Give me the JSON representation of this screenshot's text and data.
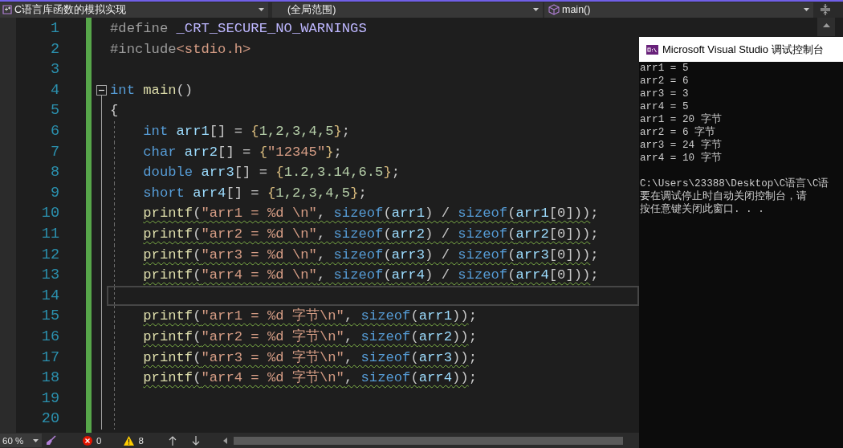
{
  "navigation_bar": {
    "project": "C语言库函数的模拟实现",
    "scope": "(全局范围)",
    "member": "main()"
  },
  "editor": {
    "change_bar": {
      "saved": true
    },
    "lines": [
      {
        "number": "1",
        "current": false,
        "tokens": [
          {
            "kind": "preprocessor",
            "text": "#define "
          },
          {
            "kind": "macro",
            "text": "_CRT_SECURE_NO_WARNINGS"
          }
        ]
      },
      {
        "number": "2",
        "current": false,
        "tokens": [
          {
            "kind": "preprocessor",
            "text": "#include"
          },
          {
            "kind": "header",
            "text": "<stdio.h>"
          }
        ]
      },
      {
        "number": "3",
        "current": false
      },
      {
        "number": "4",
        "current": false,
        "fold": {
          "expanded": true
        },
        "tokens": [
          {
            "kind": "keyword",
            "text": "int "
          },
          {
            "kind": "function",
            "text": "main"
          },
          {
            "kind": "punct",
            "text": "()"
          }
        ]
      },
      {
        "number": "5",
        "current": false,
        "tokens": [
          {
            "kind": "punct",
            "text": "{"
          }
        ]
      },
      {
        "number": "6",
        "current": false,
        "tokens": [
          {
            "kind": "indent"
          },
          {
            "kind": "keyword",
            "text": "int "
          },
          {
            "kind": "variable",
            "text": "arr1"
          },
          {
            "kind": "punct",
            "text": "[] = "
          },
          {
            "kind": "bracket",
            "text": "{"
          },
          {
            "kind": "number",
            "text": "1,2,3,4,5"
          },
          {
            "kind": "bracket",
            "text": "}"
          },
          {
            "kind": "punct",
            "text": ";"
          }
        ]
      },
      {
        "number": "7",
        "current": false,
        "tokens": [
          {
            "kind": "indent"
          },
          {
            "kind": "keyword",
            "text": "char "
          },
          {
            "kind": "variable",
            "text": "arr2"
          },
          {
            "kind": "punct",
            "text": "[] = "
          },
          {
            "kind": "bracket",
            "text": "{"
          },
          {
            "kind": "string",
            "text": "\"12345\""
          },
          {
            "kind": "bracket",
            "text": "}"
          },
          {
            "kind": "punct",
            "text": ";"
          }
        ]
      },
      {
        "number": "8",
        "current": false,
        "tokens": [
          {
            "kind": "indent"
          },
          {
            "kind": "keyword",
            "text": "double "
          },
          {
            "kind": "variable",
            "text": "arr3"
          },
          {
            "kind": "punct",
            "text": "[] = "
          },
          {
            "kind": "bracket",
            "text": "{"
          },
          {
            "kind": "number",
            "text": "1.2,3.14,6.5"
          },
          {
            "kind": "bracket",
            "text": "}"
          },
          {
            "kind": "punct",
            "text": ";"
          }
        ]
      },
      {
        "number": "9",
        "current": false,
        "tokens": [
          {
            "kind": "indent"
          },
          {
            "kind": "keyword",
            "text": "short "
          },
          {
            "kind": "variable",
            "text": "arr4"
          },
          {
            "kind": "punct",
            "text": "[] = "
          },
          {
            "kind": "bracket",
            "text": "{"
          },
          {
            "kind": "number",
            "text": "1,2,3,4,5"
          },
          {
            "kind": "bracket",
            "text": "}"
          },
          {
            "kind": "punct",
            "text": ";"
          }
        ]
      },
      {
        "number": "10",
        "current": false,
        "tokens": [
          {
            "kind": "indent"
          },
          {
            "kind": "warning",
            "tokens": [
              {
                "kind": "function",
                "text": "printf"
              },
              {
                "kind": "punct",
                "text": "("
              },
              {
                "kind": "string",
                "text": "\"arr1 = %d \\n\""
              },
              {
                "kind": "punct",
                "text": ", "
              },
              {
                "kind": "keyword",
                "text": "sizeof"
              },
              {
                "kind": "punct",
                "text": "("
              },
              {
                "kind": "variable",
                "text": "arr1"
              },
              {
                "kind": "punct",
                "text": ") / "
              },
              {
                "kind": "keyword",
                "text": "sizeof"
              },
              {
                "kind": "punct",
                "text": "("
              },
              {
                "kind": "variable",
                "text": "arr1"
              },
              {
                "kind": "punct",
                "text": "[0]))"
              }
            ]
          },
          {
            "kind": "punct",
            "text": ";"
          }
        ]
      },
      {
        "number": "11",
        "current": false,
        "tokens": [
          {
            "kind": "indent"
          },
          {
            "kind": "warning",
            "tokens": [
              {
                "kind": "function",
                "text": "printf"
              },
              {
                "kind": "punct",
                "text": "("
              },
              {
                "kind": "string",
                "text": "\"arr2 = %d \\n\""
              },
              {
                "kind": "punct",
                "text": ", "
              },
              {
                "kind": "keyword",
                "text": "sizeof"
              },
              {
                "kind": "punct",
                "text": "("
              },
              {
                "kind": "variable",
                "text": "arr2"
              },
              {
                "kind": "punct",
                "text": ") / "
              },
              {
                "kind": "keyword",
                "text": "sizeof"
              },
              {
                "kind": "punct",
                "text": "("
              },
              {
                "kind": "variable",
                "text": "arr2"
              },
              {
                "kind": "punct",
                "text": "[0]))"
              }
            ]
          },
          {
            "kind": "punct",
            "text": ";"
          }
        ]
      },
      {
        "number": "12",
        "current": false,
        "tokens": [
          {
            "kind": "indent"
          },
          {
            "kind": "warning",
            "tokens": [
              {
                "kind": "function",
                "text": "printf"
              },
              {
                "kind": "punct",
                "text": "("
              },
              {
                "kind": "string",
                "text": "\"arr3 = %d \\n\""
              },
              {
                "kind": "punct",
                "text": ", "
              },
              {
                "kind": "keyword",
                "text": "sizeof"
              },
              {
                "kind": "punct",
                "text": "("
              },
              {
                "kind": "variable",
                "text": "arr3"
              },
              {
                "kind": "punct",
                "text": ") / "
              },
              {
                "kind": "keyword",
                "text": "sizeof"
              },
              {
                "kind": "punct",
                "text": "("
              },
              {
                "kind": "variable",
                "text": "arr3"
              },
              {
                "kind": "punct",
                "text": "[0]))"
              }
            ]
          },
          {
            "kind": "punct",
            "text": ";"
          }
        ]
      },
      {
        "number": "13",
        "current": false,
        "tokens": [
          {
            "kind": "indent"
          },
          {
            "kind": "warning",
            "tokens": [
              {
                "kind": "function",
                "text": "printf"
              },
              {
                "kind": "punct",
                "text": "("
              },
              {
                "kind": "string",
                "text": "\"arr4 = %d \\n\""
              },
              {
                "kind": "punct",
                "text": ", "
              },
              {
                "kind": "keyword",
                "text": "sizeof"
              },
              {
                "kind": "punct",
                "text": "("
              },
              {
                "kind": "variable",
                "text": "arr4"
              },
              {
                "kind": "punct",
                "text": ") / "
              },
              {
                "kind": "keyword",
                "text": "sizeof"
              },
              {
                "kind": "punct",
                "text": "("
              },
              {
                "kind": "variable",
                "text": "arr4"
              },
              {
                "kind": "punct",
                "text": "[0]))"
              }
            ]
          },
          {
            "kind": "punct",
            "text": ";"
          }
        ]
      },
      {
        "number": "14",
        "current": true,
        "tokens": [
          {
            "kind": "indent"
          }
        ]
      },
      {
        "number": "15",
        "current": false,
        "tokens": [
          {
            "kind": "indent"
          },
          {
            "kind": "warning",
            "tokens": [
              {
                "kind": "function",
                "text": "printf"
              },
              {
                "kind": "punct",
                "text": "("
              },
              {
                "kind": "string",
                "text": "\"arr1 = %d 字节\\n\""
              },
              {
                "kind": "punct",
                "text": ", "
              },
              {
                "kind": "keyword",
                "text": "sizeof"
              },
              {
                "kind": "punct",
                "text": "("
              },
              {
                "kind": "variable",
                "text": "arr1"
              },
              {
                "kind": "punct",
                "text": "))"
              }
            ]
          },
          {
            "kind": "punct",
            "text": ";"
          }
        ]
      },
      {
        "number": "16",
        "current": false,
        "tokens": [
          {
            "kind": "indent"
          },
          {
            "kind": "warning",
            "tokens": [
              {
                "kind": "function",
                "text": "printf"
              },
              {
                "kind": "punct",
                "text": "("
              },
              {
                "kind": "string",
                "text": "\"arr2 = %d 字节\\n\""
              },
              {
                "kind": "punct",
                "text": ", "
              },
              {
                "kind": "keyword",
                "text": "sizeof"
              },
              {
                "kind": "punct",
                "text": "("
              },
              {
                "kind": "variable",
                "text": "arr2"
              },
              {
                "kind": "punct",
                "text": "))"
              }
            ]
          },
          {
            "kind": "punct",
            "text": ";"
          }
        ]
      },
      {
        "number": "17",
        "current": false,
        "tokens": [
          {
            "kind": "indent"
          },
          {
            "kind": "warning",
            "tokens": [
              {
                "kind": "function",
                "text": "printf"
              },
              {
                "kind": "punct",
                "text": "("
              },
              {
                "kind": "string",
                "text": "\"arr3 = %d 字节\\n\""
              },
              {
                "kind": "punct",
                "text": ", "
              },
              {
                "kind": "keyword",
                "text": "sizeof"
              },
              {
                "kind": "punct",
                "text": "("
              },
              {
                "kind": "variable",
                "text": "arr3"
              },
              {
                "kind": "punct",
                "text": "))"
              }
            ]
          },
          {
            "kind": "punct",
            "text": ";"
          }
        ]
      },
      {
        "number": "18",
        "current": false,
        "tokens": [
          {
            "kind": "indent"
          },
          {
            "kind": "warning",
            "tokens": [
              {
                "kind": "function",
                "text": "printf"
              },
              {
                "kind": "punct",
                "text": "("
              },
              {
                "kind": "string",
                "text": "\"arr4 = %d 字节\\n\""
              },
              {
                "kind": "punct",
                "text": ", "
              },
              {
                "kind": "keyword",
                "text": "sizeof"
              },
              {
                "kind": "punct",
                "text": "("
              },
              {
                "kind": "variable",
                "text": "arr4"
              },
              {
                "kind": "punct",
                "text": "))"
              }
            ]
          },
          {
            "kind": "punct",
            "text": ";"
          }
        ]
      },
      {
        "number": "19",
        "current": false,
        "tokens": [
          {
            "kind": "indent"
          }
        ]
      },
      {
        "number": "20",
        "current": false,
        "tokens": [
          {
            "kind": "indent"
          }
        ]
      }
    ]
  },
  "console": {
    "title": "Microsoft Visual Studio 调试控制台",
    "output": [
      "arr1 = 5",
      "arr2 = 6",
      "arr3 = 3",
      "arr4 = 5",
      "arr1 = 20 字节",
      "arr2 = 6 字节",
      "arr3 = 24 字节",
      "arr4 = 10 字节"
    ],
    "exit_message": [
      "C:\\Users\\23388\\Desktop\\C语言\\C语",
      "要在调试停止时自动关闭控制台，请",
      "按任意键关闭此窗口. . ."
    ]
  },
  "status_bar": {
    "zoom": "60 %",
    "errors": "0",
    "warnings": "8"
  }
}
